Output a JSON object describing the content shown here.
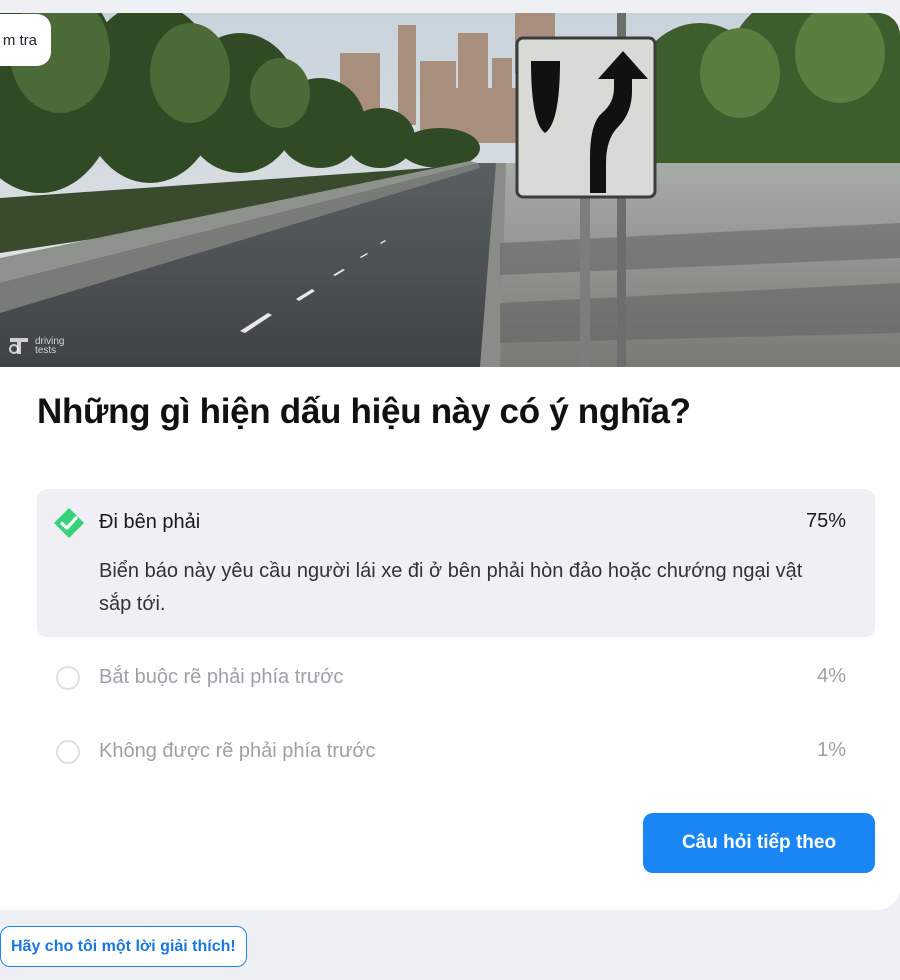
{
  "quiz_tag": "m tra",
  "watermark": "driving tests",
  "question": "Những gì hiện dấu hiệu này có ý nghĩa?",
  "options": [
    {
      "label": "Đi bên phải",
      "percent": "75%",
      "explanation": "Biển báo này yêu cầu người lái xe đi ở bên phải hòn đảo hoặc chướng ngại vật sắp tới.",
      "state": "correct-selected"
    },
    {
      "label": "Bắt buộc rẽ phải phía trước",
      "percent": "4%",
      "state": "unselected"
    },
    {
      "label": "Không được rẽ phải phía trước",
      "percent": "1%",
      "state": "unselected"
    }
  ],
  "next_button_label": "Câu hỏi tiếp theo",
  "explain_button_label": "Hãy cho tôi một lời giải thích!",
  "colors": {
    "accent": "#1a86f5",
    "correct": "#34d27b",
    "background": "#eef0f5"
  }
}
